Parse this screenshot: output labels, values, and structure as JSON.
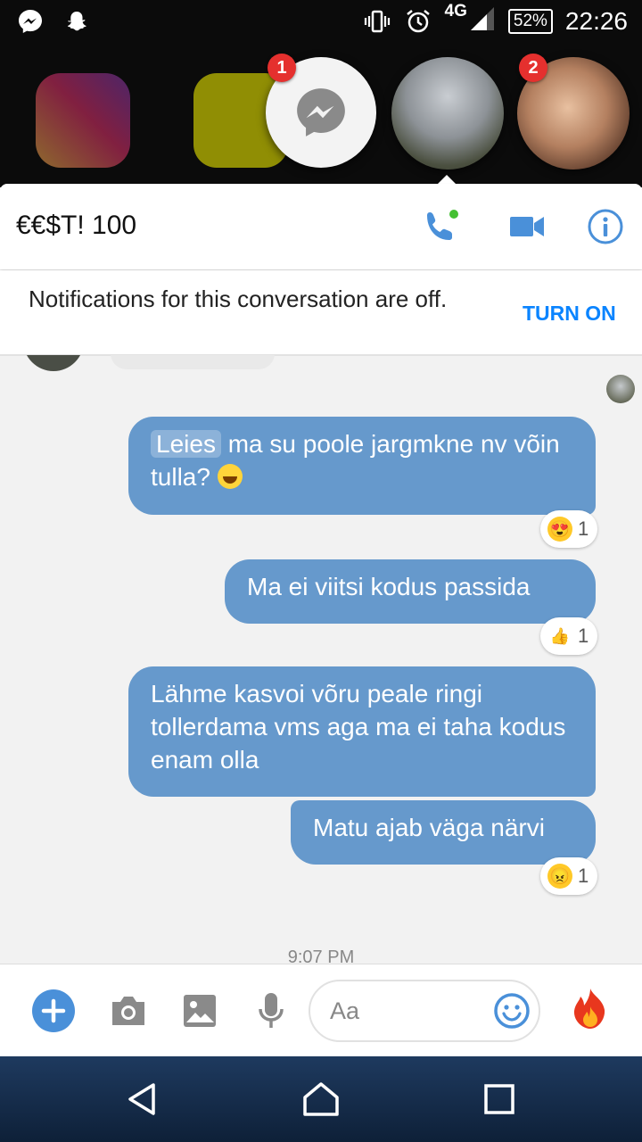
{
  "status_bar": {
    "network": "4G",
    "battery": "52%",
    "time": "22:26"
  },
  "chat_heads": {
    "messenger_badge": "1",
    "contact_badge": "2"
  },
  "header": {
    "title": "€€$T! 100"
  },
  "banner": {
    "text": "Notifications for this conversation are off.",
    "action": "TURN ON"
  },
  "messages": [
    {
      "mention": "Leies",
      "text": " ma su poole jargmkne nv võin tulla? ",
      "reaction_count": "1"
    },
    {
      "text": "Ma ei viitsi kodus passida",
      "reaction_count": "1"
    },
    {
      "text": "Lähme kasvoi võru peale ringi tollerdama vms aga ma ei taha kodus enam olla"
    },
    {
      "text": "Matu ajab väga närvi",
      "reaction_count": "1"
    }
  ],
  "reactions": {
    "r1": "😍",
    "r2": "👍",
    "r3": "😠"
  },
  "timestamp": "9:07 PM",
  "composer": {
    "placeholder": "Aa"
  },
  "colors": {
    "bubble": "#6699cc",
    "accent": "#0a84ff",
    "badge": "#e5302e"
  },
  "icons": [
    "messenger-icon",
    "snapchat-icon",
    "vibrate-icon",
    "alarm-icon",
    "signal-icon",
    "phone-icon",
    "video-icon",
    "info-icon",
    "plus-icon",
    "camera-icon",
    "image-icon",
    "mic-icon",
    "smiley-icon",
    "fire-icon",
    "back-icon",
    "home-icon",
    "recents-icon"
  ]
}
